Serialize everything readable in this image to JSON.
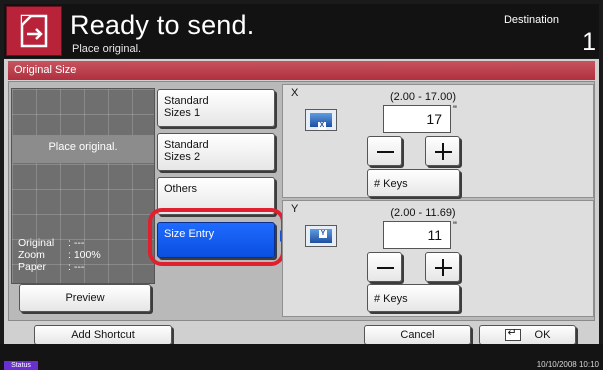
{
  "header": {
    "title": "Ready to send.",
    "subtitle": "Place original.",
    "destination_label": "Destination",
    "destination_count": "1"
  },
  "tab": {
    "label": "Original Size"
  },
  "preview": {
    "message": "Place original.",
    "info": [
      {
        "label": "Original",
        "value": ": ---"
      },
      {
        "label": "Zoom",
        "value": ": 100%"
      },
      {
        "label": "Paper",
        "value": ": ---"
      }
    ],
    "button_label": "Preview"
  },
  "options": [
    {
      "line1": "Standard",
      "line2": "Sizes 1"
    },
    {
      "line1": "Standard",
      "line2": "Sizes 2"
    },
    {
      "line1": "Others",
      "line2": ""
    },
    {
      "line1": "Size Entry",
      "line2": "",
      "selected": true
    }
  ],
  "x_axis": {
    "label": "X",
    "range": "(2.00 - 17.00)",
    "value": "17",
    "unit": "\"",
    "keys_label": "# Keys",
    "icon": "x-dimension-icon"
  },
  "y_axis": {
    "label": "Y",
    "range": "(2.00 - 11.69)",
    "value": "11",
    "unit": "\"",
    "keys_label": "# Keys",
    "icon": "y-dimension-icon"
  },
  "footer": {
    "add_shortcut": "Add Shortcut",
    "cancel": "Cancel",
    "ok": "OK"
  },
  "status": {
    "tab": "Status",
    "datetime": "10/10/2008   10:10"
  },
  "colors": {
    "accent": "#b8233a",
    "selected": "#1f6bff",
    "highlight": "#e0202f"
  }
}
